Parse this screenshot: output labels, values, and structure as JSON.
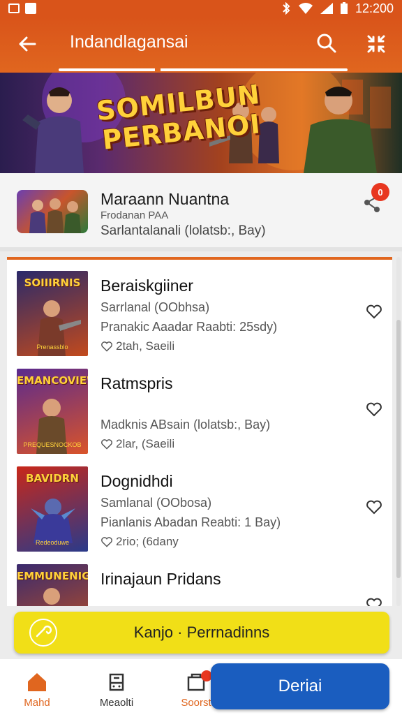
{
  "status_bar": {
    "time": "12:200"
  },
  "app_bar": {
    "title": "Indandlagansai"
  },
  "hero": {
    "title_line1": "SOMILBUN",
    "title_line2": "PERBANOI"
  },
  "featured": {
    "name": "Maraann Nuantna",
    "subtitle": "Frodanan PAA",
    "meta": "Sarlantalanali (lolatsb:, Bay)",
    "badge": "0"
  },
  "items": [
    {
      "title": "Beraiskgiiner",
      "line1": "Sarrlanal (OObhsa)",
      "line2": "Pranakic Aaadar Raabti: 25sdy)",
      "likes": "2tah, Saeili",
      "cover_text": "SOIIIRNIS",
      "cover_foot": "Prenassblo",
      "colors": [
        "#3a3a8a",
        "#c24a1d"
      ]
    },
    {
      "title": "Ratmspris",
      "line1": "",
      "line2": "Madknis ABsain (lolatsb:, Bay)",
      "likes": "2lar, (Saeili",
      "cover_text": "EMANCOVIEW",
      "cover_foot": "PREQUESNOCKOB",
      "colors": [
        "#5a2a8e",
        "#d9542a"
      ]
    },
    {
      "title": "Dognidhdi",
      "line1": "Samlanal (OObosa)",
      "line2": "Pianlanis Abadan Reabti: 1 Bay)",
      "likes": "2rio; (6dany",
      "cover_text": "BAVIDRN",
      "cover_foot": "Redeoduwe",
      "colors": [
        "#a8281a",
        "#2a5aa8"
      ]
    },
    {
      "title": "Irinajaun Pridans",
      "line1": "",
      "line2": "",
      "likes": "",
      "cover_text": "EMMUNENIG",
      "cover_foot": "",
      "colors": [
        "#3a2a6e",
        "#c8541d"
      ]
    }
  ],
  "cta": {
    "label": "Kanjo · Perrnadinns"
  },
  "nav": [
    {
      "label": "Mahd"
    },
    {
      "label": "Meaolti"
    },
    {
      "label": "Soorst"
    }
  ],
  "fab": {
    "label": "Deriai"
  },
  "colors": {
    "primary": "#e0661f",
    "cta": "#f1df17",
    "fab": "#1a5dbf"
  }
}
